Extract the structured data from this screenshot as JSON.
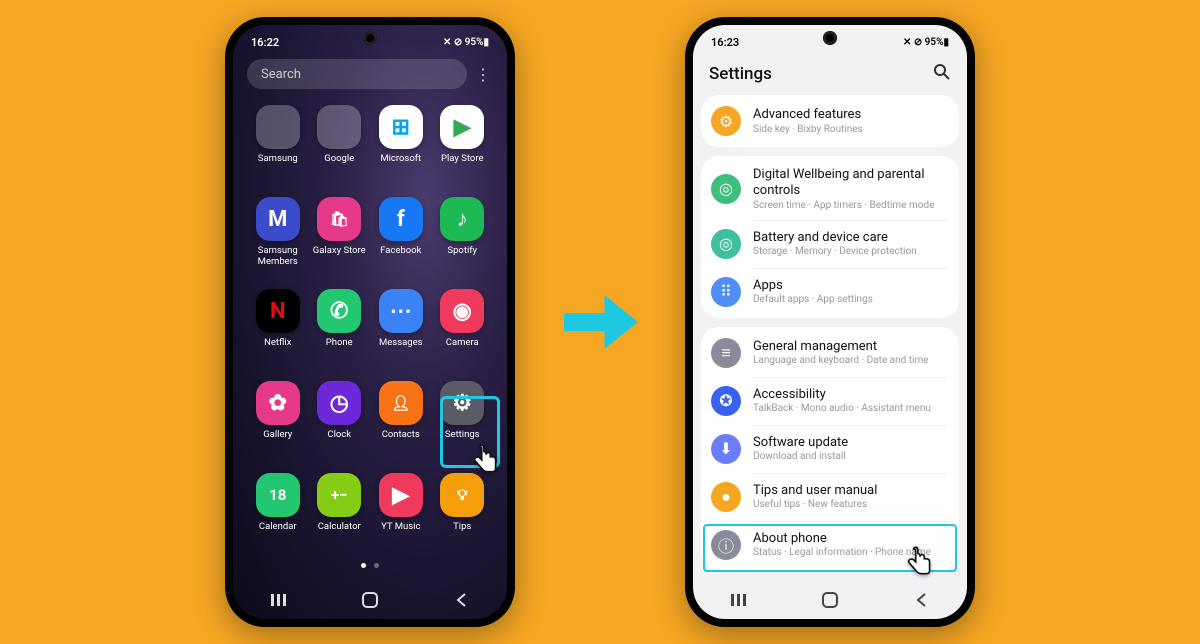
{
  "phone1": {
    "status": {
      "time": "16:22",
      "icons": "✕ ⊘ 95%▮"
    },
    "search": {
      "placeholder": "Search"
    },
    "apps": [
      {
        "label": "Samsung",
        "type": "folder",
        "colors": [
          "#f5a623",
          "#d44",
          "#5a7",
          "#48c",
          "#fc3",
          "#3bf",
          "#f7a",
          "#a6f",
          "#6d4"
        ]
      },
      {
        "label": "Google",
        "type": "folder",
        "colors": [
          "#fff",
          "#ea4335",
          "#34a853",
          "#4285f4",
          "#fbbc05",
          "#ea4335",
          "#34a853",
          "#4285f4",
          "#fbbc05"
        ]
      },
      {
        "label": "Microsoft",
        "type": "icon",
        "bg": "#fff",
        "glyph": "⊞",
        "fg": "#00a4ef"
      },
      {
        "label": "Play Store",
        "type": "icon",
        "bg": "#fff",
        "glyph": "▶",
        "fg": "#34a853"
      },
      {
        "label": "Samsung\nMembers",
        "type": "icon",
        "bg": "#3b4cca",
        "glyph": "M"
      },
      {
        "label": "Galaxy Store",
        "type": "icon",
        "bg": "#e6398a",
        "glyph": "🛍︎"
      },
      {
        "label": "Facebook",
        "type": "icon",
        "bg": "#1877f2",
        "glyph": "f"
      },
      {
        "label": "Spotify",
        "type": "icon",
        "bg": "#1db954",
        "glyph": "♪"
      },
      {
        "label": "Netflix",
        "type": "icon",
        "bg": "#000",
        "glyph": "N",
        "fg": "#e50914"
      },
      {
        "label": "Phone",
        "type": "icon",
        "bg": "#22c76f",
        "glyph": "✆"
      },
      {
        "label": "Messages",
        "type": "icon",
        "bg": "#3b82f6",
        "glyph": "⋯"
      },
      {
        "label": "Camera",
        "type": "icon",
        "bg": "#ef3a5d",
        "glyph": "◉"
      },
      {
        "label": "Gallery",
        "type": "icon",
        "bg": "#e6398a",
        "glyph": "✿"
      },
      {
        "label": "Clock",
        "type": "icon",
        "bg": "#6d28d9",
        "glyph": "◷"
      },
      {
        "label": "Contacts",
        "type": "icon",
        "bg": "#f97316",
        "glyph": "👤︎"
      },
      {
        "label": "Settings",
        "type": "icon",
        "bg": "#5b5b66",
        "glyph": "⚙"
      },
      {
        "label": "Calendar",
        "type": "icon",
        "bg": "#22c76f",
        "glyph": "18"
      },
      {
        "label": "Calculator",
        "type": "icon",
        "bg": "#84cc16",
        "glyph": "+−"
      },
      {
        "label": "YT Music",
        "type": "icon",
        "bg": "#ef3a5d",
        "glyph": "▶"
      },
      {
        "label": "Tips",
        "type": "icon",
        "bg": "#f59e0b",
        "glyph": "💡︎"
      }
    ]
  },
  "phone2": {
    "status": {
      "time": "16:23",
      "icons": "✕ ⊘ 95%▮"
    },
    "header": {
      "title": "Settings"
    },
    "groups": [
      [
        {
          "title": "Advanced features",
          "sub": "Side key · Bixby Routines",
          "ico": "⚙",
          "bg": "#f5a623"
        }
      ],
      [
        {
          "title": "Digital Wellbeing and parental controls",
          "sub": "Screen time · App timers · Bedtime mode",
          "ico": "◎",
          "bg": "#3fbf7f"
        },
        {
          "title": "Battery and device care",
          "sub": "Storage · Memory · Device protection",
          "ico": "◎",
          "bg": "#3fbf9f"
        },
        {
          "title": "Apps",
          "sub": "Default apps · App settings",
          "ico": "⠿",
          "bg": "#4f8ef7"
        }
      ],
      [
        {
          "title": "General management",
          "sub": "Language and keyboard · Date and time",
          "ico": "≡",
          "bg": "#8a8a98"
        },
        {
          "title": "Accessibility",
          "sub": "TalkBack · Mono audio · Assistant menu",
          "ico": "✪",
          "bg": "#3a62f0"
        },
        {
          "title": "Software update",
          "sub": "Download and install",
          "ico": "⬇",
          "bg": "#6b7dfb"
        },
        {
          "title": "Tips and user manual",
          "sub": "Useful tips · New features",
          "ico": "●",
          "bg": "#f5a623"
        },
        {
          "title": "About phone",
          "sub": "Status · Legal information · Phone name",
          "ico": "ⓘ",
          "bg": "#8a8a98"
        }
      ]
    ]
  }
}
